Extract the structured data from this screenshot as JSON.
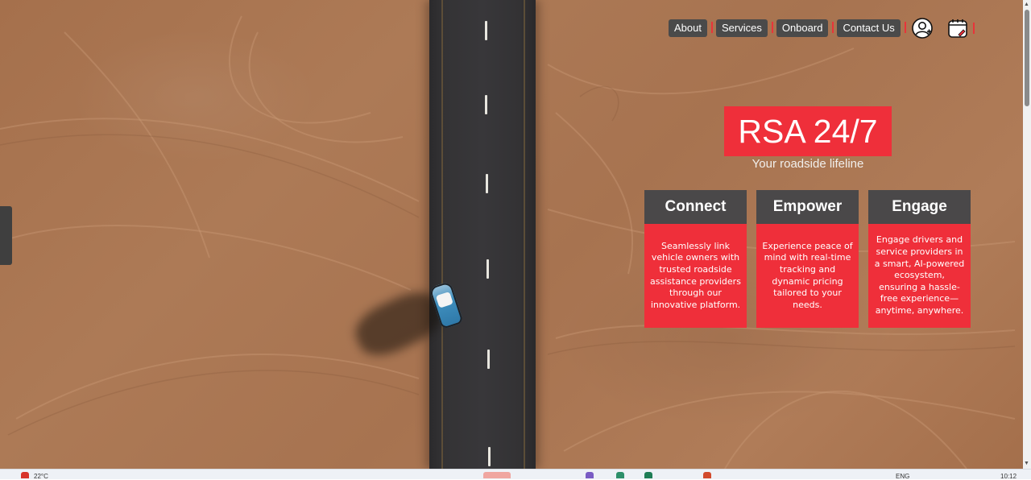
{
  "nav": {
    "items": [
      "About",
      "Services",
      "Onboard",
      "Contact Us"
    ],
    "icons": [
      "user-add-icon",
      "calendar-icon"
    ]
  },
  "hero": {
    "title": "RSA 24/7",
    "subtitle": "Your roadside lifeline"
  },
  "cards": [
    {
      "title": "Connect",
      "body": "Seamlessly link vehicle owners with trusted roadside assistance providers through our innovative platform."
    },
    {
      "title": "Empower",
      "body": "Experience peace of mind with real-time tracking and dynamic pricing tailored to your needs."
    },
    {
      "title": "Engage",
      "body": "Engage drivers and service providers in a smart, AI-powered ecosystem, ensuring a hassle-free experience—anytime, anywhere."
    }
  ],
  "taskbar": {
    "weather": "22°C",
    "language": "ENG",
    "time": "10:12"
  },
  "colors": {
    "accent": "#ef2f3a",
    "dark": "#4a4849"
  }
}
